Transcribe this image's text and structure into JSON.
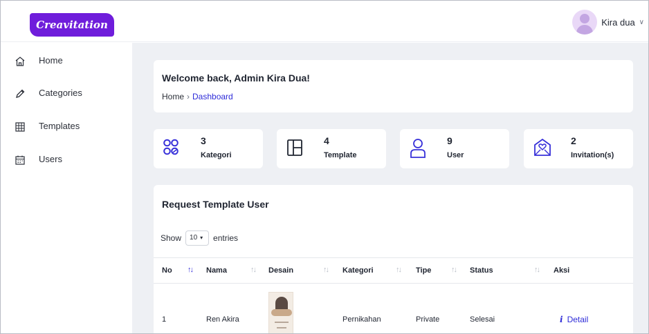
{
  "app": {
    "logo_text": "Creavitation"
  },
  "user_menu": {
    "name": "Kira dua",
    "chevron": "∨"
  },
  "sidebar": {
    "items": [
      {
        "label": "Home",
        "icon": "home-icon"
      },
      {
        "label": "Categories",
        "icon": "pencil-icon"
      },
      {
        "label": "Templates",
        "icon": "grid-icon"
      },
      {
        "label": "Users",
        "icon": "calendar-icon"
      }
    ]
  },
  "welcome": {
    "title": "Welcome back, Admin Kira Dua!",
    "breadcrumb": {
      "home": "Home",
      "separator": "›",
      "current": "Dashboard"
    }
  },
  "stats": [
    {
      "value": "3",
      "label": "Kategori",
      "icon": "categories-icon"
    },
    {
      "value": "4",
      "label": "Template",
      "icon": "layout-icon"
    },
    {
      "value": "9",
      "label": "User",
      "icon": "user-icon"
    },
    {
      "value": "2",
      "label": "Invitation(s)",
      "icon": "heart-envelope-icon"
    }
  ],
  "table": {
    "title": "Request Template User",
    "show_label": "Show",
    "entries_value": "10",
    "entries_label": "entries",
    "columns": [
      "No",
      "Nama",
      "Desain",
      "Kategori",
      "Tipe",
      "Status",
      "Aksi"
    ],
    "rows": [
      {
        "no": "1",
        "nama": "Ren Akira",
        "kategori": "Pernikahan",
        "tipe": "Private",
        "status": "Selesai",
        "aksi": "Detail"
      }
    ]
  },
  "colors": {
    "brand": "#6f1ddb",
    "link": "#2d2bd8",
    "background": "#eef0f4"
  }
}
